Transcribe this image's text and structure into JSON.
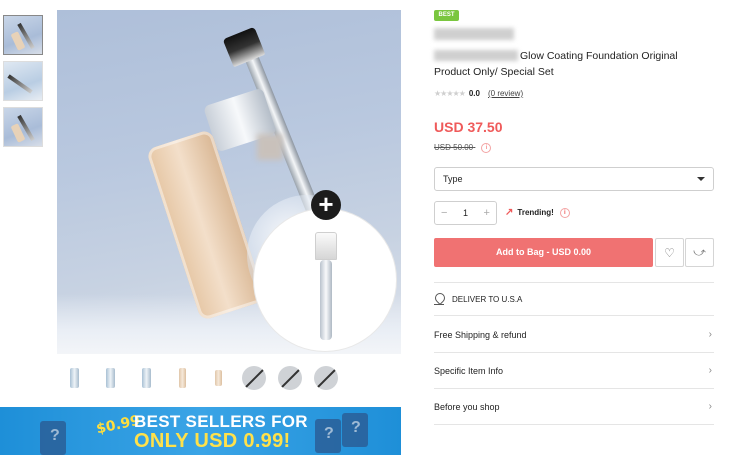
{
  "gallery": {
    "thumbs": [
      "thumb-1",
      "thumb-2",
      "thumb-3"
    ],
    "zoom_icon": "plus-icon"
  },
  "product": {
    "badge": "BEST",
    "title_visible": "Glow Coating Foundation Original Product Only/ Special Set",
    "stars": "★★★★★",
    "rating": "0.0",
    "reviews": "(0 review)",
    "price": "USD 37.50",
    "old_price": "USD 50.00",
    "info_glyph": "i"
  },
  "options": {
    "type_label": "Type",
    "qty": "1",
    "minus": "−",
    "plus": "+",
    "trending": "Trending!",
    "trend_icon": "↗"
  },
  "actions": {
    "add_to_bag": "Add to Bag - USD 0.00",
    "wishlist_icon": "♡",
    "share_icon": "⤻"
  },
  "delivery": {
    "label": "DELIVER TO U.S.A"
  },
  "sections": [
    {
      "label": "Free Shipping & refund"
    },
    {
      "label": "Specific Item Info"
    },
    {
      "label": "Before you shop"
    }
  ],
  "banner": {
    "badge": "$0.99",
    "line1": "BEST SELLERS FOR",
    "line2": "ONLY USD 0.99!",
    "mystery": "?"
  },
  "colors": {
    "accent": "#f07272",
    "price": "#ef5a5a",
    "best_badge": "#7ac63f",
    "banner_bg": "#1e8fd8"
  }
}
